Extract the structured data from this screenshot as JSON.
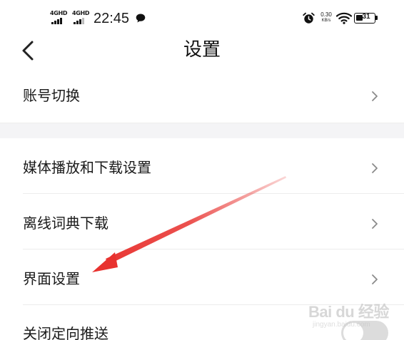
{
  "status_bar": {
    "signal_1_label": "4GHD",
    "signal_2_label": "4GHD",
    "time": "22:45",
    "net_speed_value": "0.30",
    "net_speed_unit": "KB/s",
    "battery_level": "31",
    "icons": [
      "chat-bubble-icon",
      "alarm-icon",
      "wifi-icon",
      "battery-icon"
    ]
  },
  "header": {
    "title": "设置",
    "back_icon": "chevron-left-icon"
  },
  "settings": {
    "items": [
      {
        "label": "账号切换",
        "type": "link"
      },
      {
        "label": "媒体播放和下载设置",
        "type": "link"
      },
      {
        "label": "离线词典下载",
        "type": "link"
      },
      {
        "label": "界面设置",
        "type": "link"
      },
      {
        "label": "关闭定向推送",
        "type": "toggle",
        "toggle_on": false
      }
    ]
  },
  "annotation": {
    "type": "arrow",
    "color": "#e8322f",
    "target": "界面设置"
  },
  "watermark": {
    "text": "Bai du 经验",
    "sub_text": "jingyan.baidu.com"
  },
  "colors": {
    "background": "#ffffff",
    "section_gap": "#f4f4f6",
    "divider": "#ececec",
    "chevron": "#8a8a8a",
    "toggle_off": "#dcdcdc"
  }
}
